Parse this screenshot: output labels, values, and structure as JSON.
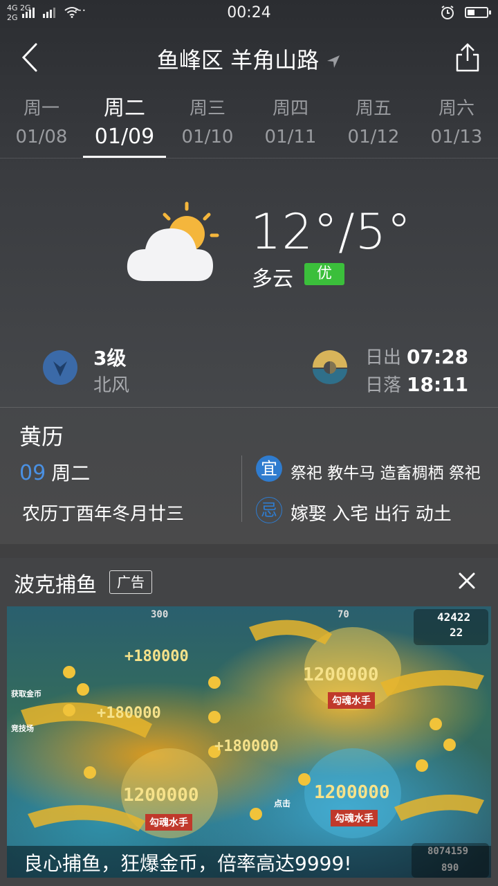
{
  "status_bar": {
    "signal_1": "4G",
    "signal_2": "2G",
    "signal_2b": "2G",
    "more": "···",
    "time": "00:24"
  },
  "header": {
    "title": "鱼峰区 羊角山路"
  },
  "tabs": [
    {
      "dow": "周一",
      "date": "01/08"
    },
    {
      "dow": "周二",
      "date": "01/09",
      "active": true
    },
    {
      "dow": "周三",
      "date": "01/10"
    },
    {
      "dow": "周四",
      "date": "01/11"
    },
    {
      "dow": "周五",
      "date": "01/12"
    },
    {
      "dow": "周六",
      "date": "01/13"
    }
  ],
  "weather": {
    "temp": "12°/5°",
    "condition": "多云",
    "aqi": "优",
    "icon": "partly-cloudy-icon"
  },
  "wind": {
    "level": "3级",
    "direction": "北风"
  },
  "sun": {
    "sunrise_label": "日出",
    "sunrise_time": "07:28",
    "sunset_label": "日落",
    "sunset_time": "18:11"
  },
  "almanac": {
    "title": "黄历",
    "day_num": "09",
    "weekday": "周二",
    "lunar": "农历丁酉年冬月廿三",
    "yi_label": "宜",
    "yi_text": "祭祀 教牛马 造畜椆栖 祭祀",
    "ji_label": "忌",
    "ji_text": "嫁娶 入宅 出行 动土"
  },
  "ad": {
    "title": "波克捕鱼",
    "tag": "广告",
    "caption": "良心捕鱼，狂爆金币，倍率高达9999!",
    "score_top": "42422",
    "gems": "22",
    "bet_left": "300",
    "bet_right": "70",
    "prize_1": "1200000",
    "prize_2": "1200000",
    "prize_3": "1200000",
    "badge_1": "勾魂水手",
    "badge_2": "勾魂水手",
    "badge_3": "勾魂水手",
    "bonus": "+180000",
    "side_label": "获取金币",
    "side_label_2": "竞技场",
    "click_label": "点击",
    "coins_bottom": "8074159",
    "gems_bottom": "890"
  },
  "colors": {
    "aqi_good": "#3bbf3b",
    "accent_blue": "#4a90e2"
  }
}
